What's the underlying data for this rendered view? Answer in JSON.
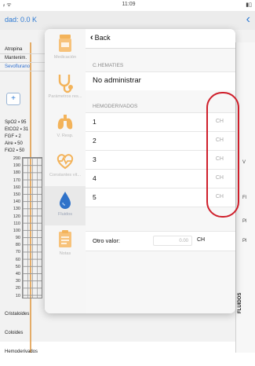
{
  "status_bar": {
    "signal": "ᵢₗ ᯤ",
    "time": "11:09",
    "battery": "▮▯"
  },
  "background": {
    "title": "dad: 0.0 K",
    "nav_chevron": "‹",
    "drugs": [
      {
        "label": "Atropina",
        "style": "normal"
      },
      {
        "label": "Mantenim.",
        "style": "normal"
      },
      {
        "label": "Sevoflurano",
        "style": "blue"
      }
    ],
    "add_button": "+",
    "vitals": [
      "SpO2 ▪ 95",
      "EtCO2 ▪ 31",
      "FGF ▪ 2",
      "Aire ▪ 50",
      "FiO2 ▪ 50"
    ],
    "scale": [
      "200",
      "190",
      "180",
      "170",
      "160",
      "150",
      "140",
      "130",
      "120",
      "110",
      "100",
      "90",
      "80",
      "70",
      "60",
      "50",
      "40",
      "30",
      "20",
      "10"
    ],
    "bottom_labels": [
      "Cristaloides",
      "Coloides",
      "Hemoderivados"
    ],
    "right_labels": [
      "V",
      "Fl",
      "Pl",
      "Pl"
    ],
    "right_section": "FLUIDOS"
  },
  "modal": {
    "back_label": "Back",
    "tabs": [
      {
        "name": "medicacion",
        "label": "Medicación",
        "icon": "medication-icon",
        "active": false
      },
      {
        "name": "parametros",
        "label": "Parámetros res...",
        "icon": "stethoscope-icon",
        "active": false
      },
      {
        "name": "vresp",
        "label": "V. Resp.",
        "icon": "lungs-icon",
        "active": false
      },
      {
        "name": "constantes",
        "label": "Constantes vit...",
        "icon": "heartbeat-icon",
        "active": false
      },
      {
        "name": "fluidos",
        "label": "Fluidos",
        "icon": "drop-icon",
        "active": true
      },
      {
        "name": "notas",
        "label": "Notas",
        "icon": "notes-icon",
        "active": false
      }
    ],
    "chematies": {
      "header": "C.HEMATIES",
      "value": "No administrar"
    },
    "hemoderivados": {
      "header": "HEMODERIVADOS",
      "rows": [
        {
          "label": "1",
          "unit": "CH"
        },
        {
          "label": "2",
          "unit": "CH"
        },
        {
          "label": "3",
          "unit": "CH"
        },
        {
          "label": "4",
          "unit": "CH"
        },
        {
          "label": "5",
          "unit": "CH"
        }
      ]
    },
    "otro": {
      "label": "Otro valor:",
      "value": "0.00",
      "unit": "CH"
    }
  },
  "colors": {
    "accent": "#2f7bd4",
    "orange": "#e09a45",
    "highlight": "#cf1f2b"
  }
}
